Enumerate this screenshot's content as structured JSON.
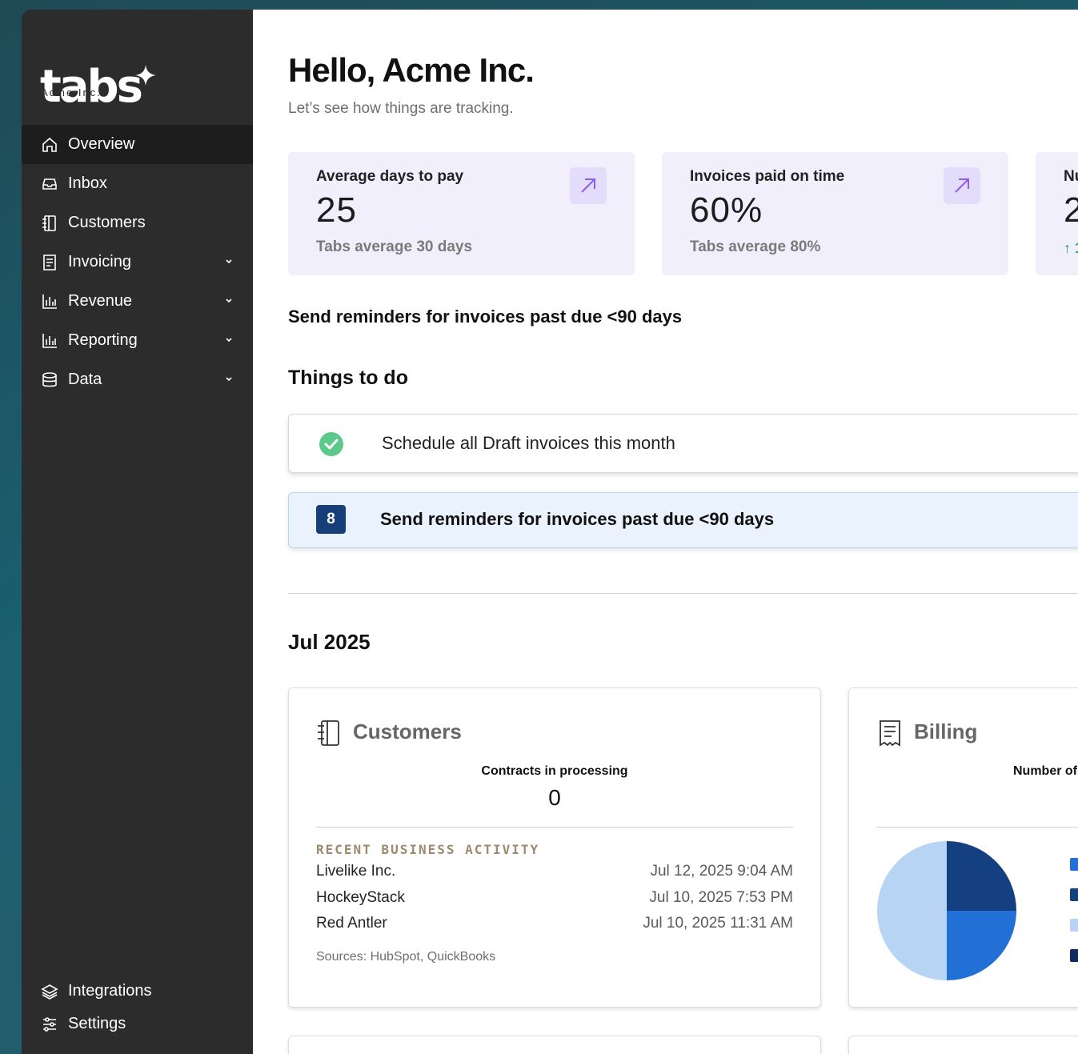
{
  "brand": {
    "logo_text": "tabs",
    "logo_overlay": "Acme Inc."
  },
  "sidebar": {
    "items": [
      {
        "label": "Overview",
        "icon": "home-icon",
        "active": true
      },
      {
        "label": "Inbox",
        "icon": "inbox-icon"
      },
      {
        "label": "Customers",
        "icon": "notebook-icon"
      },
      {
        "label": "Invoicing",
        "icon": "receipt-icon",
        "expandable": true
      },
      {
        "label": "Revenue",
        "icon": "bar-chart-icon",
        "expandable": true
      },
      {
        "label": "Reporting",
        "icon": "bar-chart-icon",
        "expandable": true
      },
      {
        "label": "Data",
        "icon": "database-icon",
        "expandable": true
      }
    ],
    "bottom": [
      {
        "label": "Integrations",
        "icon": "layers-icon"
      },
      {
        "label": "Settings",
        "icon": "sliders-icon"
      }
    ]
  },
  "header": {
    "greeting": "Hello, Acme Inc.",
    "subtitle": "Let’s see how things are tracking."
  },
  "stats": [
    {
      "label": "Average days to pay",
      "value": "25",
      "note": "Tabs average 30 days"
    },
    {
      "label": "Invoices paid on time",
      "value": "60%",
      "note": "Tabs average 80%"
    },
    {
      "label": "Nu",
      "value": "2",
      "note": "↑ 1"
    }
  ],
  "reminder_heading": "Send reminders for invoices past due <90 days",
  "todo": {
    "heading": "Things to do",
    "items": [
      {
        "text": "Schedule all Draft invoices this month",
        "done": true
      },
      {
        "text": "Send reminders for invoices past due <90 days",
        "count": "8"
      }
    ]
  },
  "period": {
    "label": "Jul 2025"
  },
  "customers_card": {
    "title": "Customers",
    "metric_label": "Contracts in processing",
    "metric_value": "0",
    "activity_title": "RECENT BUSINESS ACTIVITY",
    "activity": [
      {
        "name": "Livelike Inc.",
        "date": "Jul 12, 2025 9:04 AM"
      },
      {
        "name": "HockeyStack",
        "date": "Jul 10, 2025 7:53 PM"
      },
      {
        "name": "Red Antler",
        "date": "Jul 10, 2025 11:31 AM"
      }
    ],
    "sources": "Sources: HubSpot, QuickBooks"
  },
  "billing_card": {
    "title": "Billing",
    "metric_label": "Number of"
  },
  "chart_data": {
    "type": "pie",
    "values": [
      25,
      25,
      50
    ],
    "colors": [
      "#143f80",
      "#2270d6",
      "#b8d4f5"
    ],
    "legend_colors": [
      "#2270d6",
      "#143f80",
      "#b8d4f5",
      "#0f2c5c"
    ]
  },
  "colors": {
    "sidebar_bg": "#2c2c2c",
    "stat_bg": "#f1effc",
    "accent_purple": "#8b5cf6",
    "badge_blue": "#163f7a",
    "success_green": "#5cc98a"
  }
}
